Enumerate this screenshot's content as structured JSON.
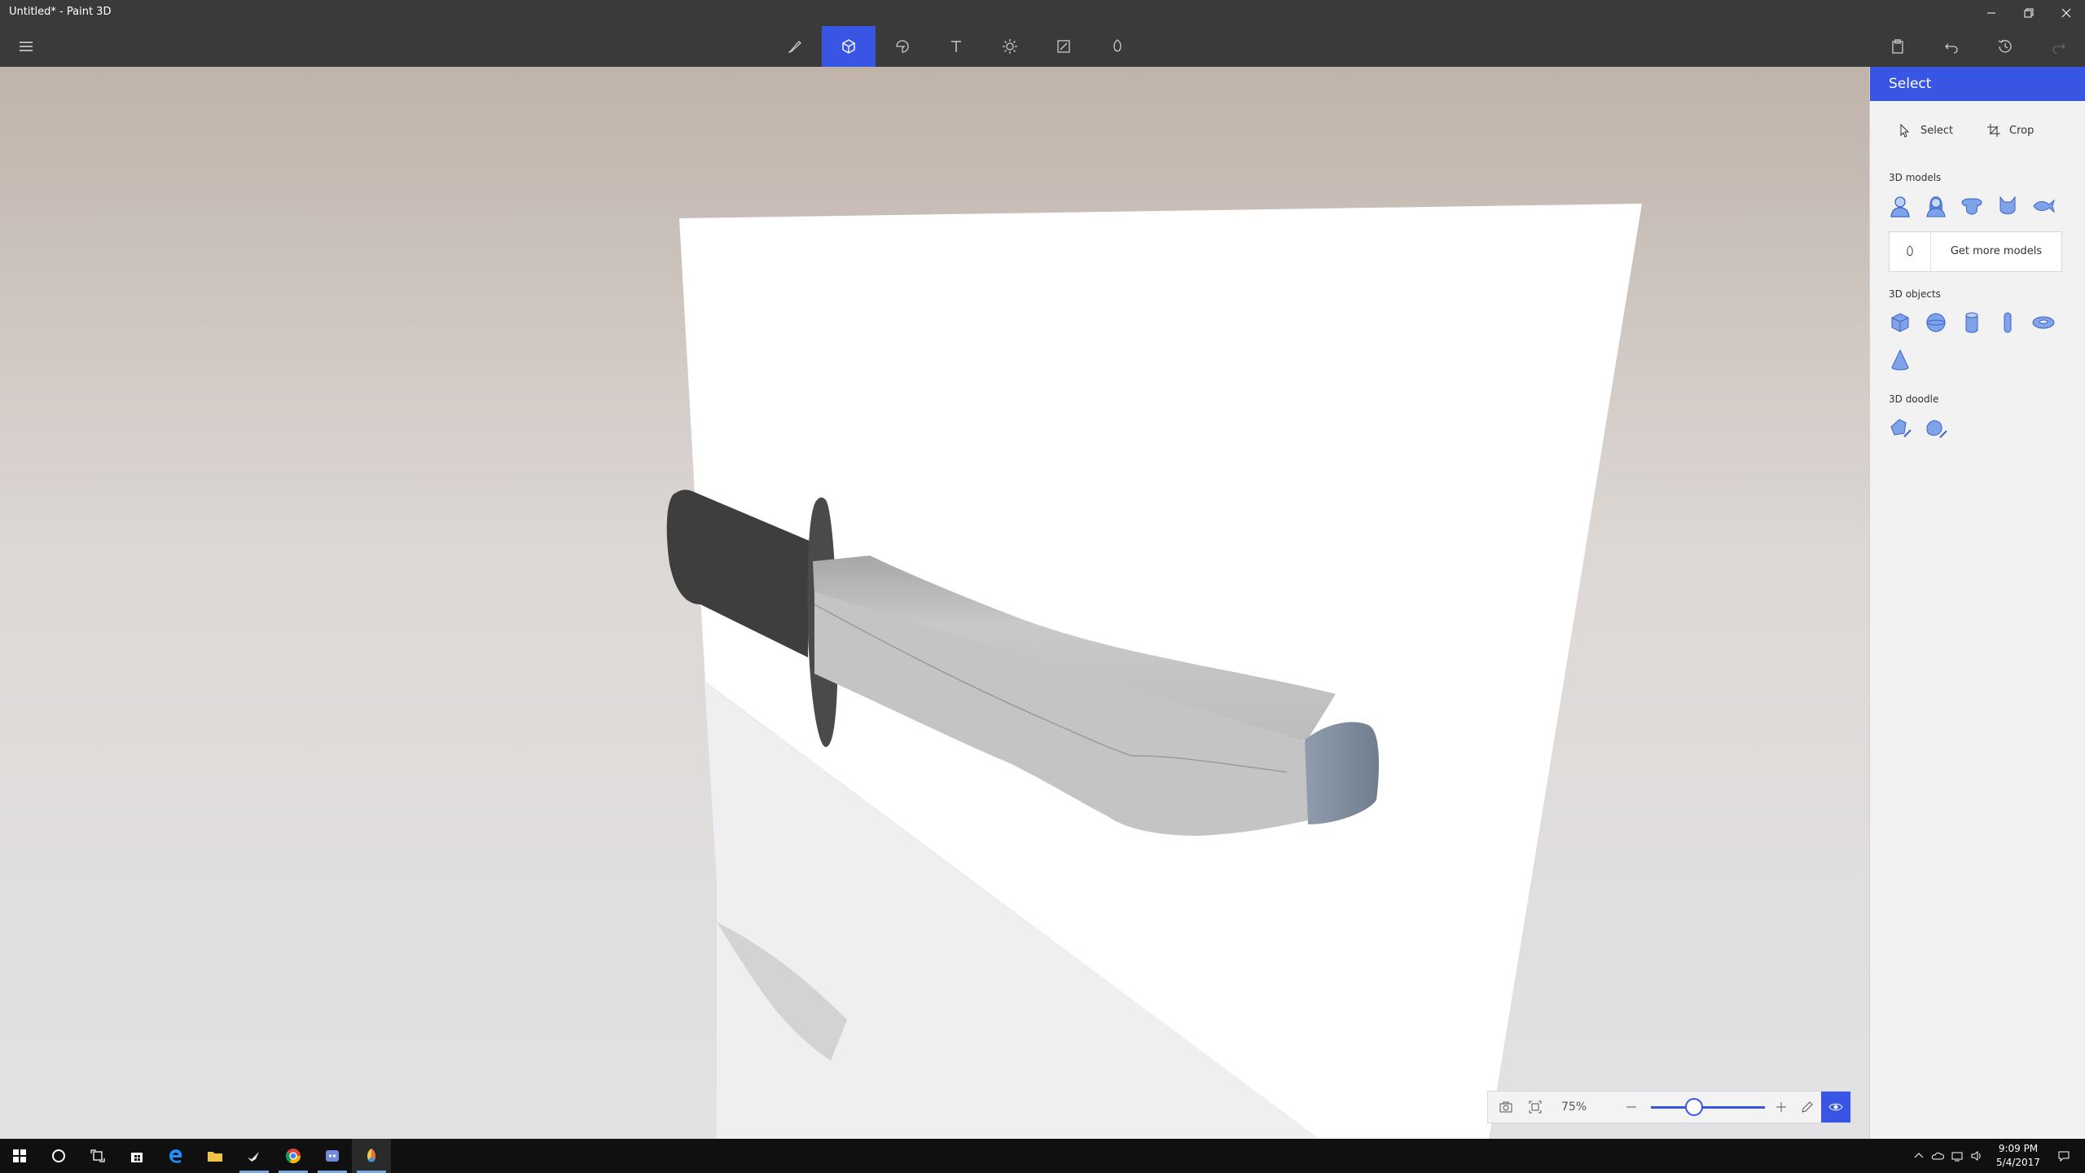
{
  "window": {
    "title": "Untitled* - Paint 3D"
  },
  "toolbar": {
    "tools": [
      {
        "name": "brushes",
        "icon": "brush-icon"
      },
      {
        "name": "3D shapes",
        "icon": "cube-icon",
        "active": true
      },
      {
        "name": "stickers",
        "icon": "sticker-icon"
      },
      {
        "name": "text",
        "icon": "text-icon"
      },
      {
        "name": "effects",
        "icon": "sun-icon"
      },
      {
        "name": "canvas",
        "icon": "canvas-icon"
      },
      {
        "name": "remix 3D",
        "icon": "remix-icon"
      }
    ],
    "right_icons": [
      "paste-icon",
      "undo-icon",
      "history-icon",
      "redo-icon"
    ]
  },
  "panel": {
    "title": "Select",
    "select_label": "Select",
    "crop_label": "Crop",
    "models_heading": "3D models",
    "models": [
      "man-model-icon",
      "woman-model-icon",
      "dog-model-icon",
      "cat-model-icon",
      "fish-model-icon"
    ],
    "get_more_label": "Get more models",
    "objects_heading": "3D objects",
    "objects": [
      "cube-icon",
      "sphere-icon",
      "cylinder-icon",
      "capsule-icon",
      "torus-icon",
      "cone-icon"
    ],
    "doodle_heading": "3D doodle",
    "doodles": [
      "sharp-doodle-icon",
      "soft-doodle-icon"
    ]
  },
  "zoom": {
    "value": "75%",
    "level": 0.375
  },
  "taskbar": {
    "apps": [
      "start-icon",
      "cortana-icon",
      "task-view-icon",
      "store-icon",
      "edge-icon",
      "file-explorer-icon",
      "steam-icon",
      "chrome-icon",
      "discord-icon",
      "paint3d-icon"
    ],
    "time": "9:09 PM",
    "date": "5/4/2017"
  },
  "colors": {
    "accent": "#3955e3",
    "toolbar_bg": "#3a3a3a",
    "panel_bg": "#f2f2f2"
  }
}
